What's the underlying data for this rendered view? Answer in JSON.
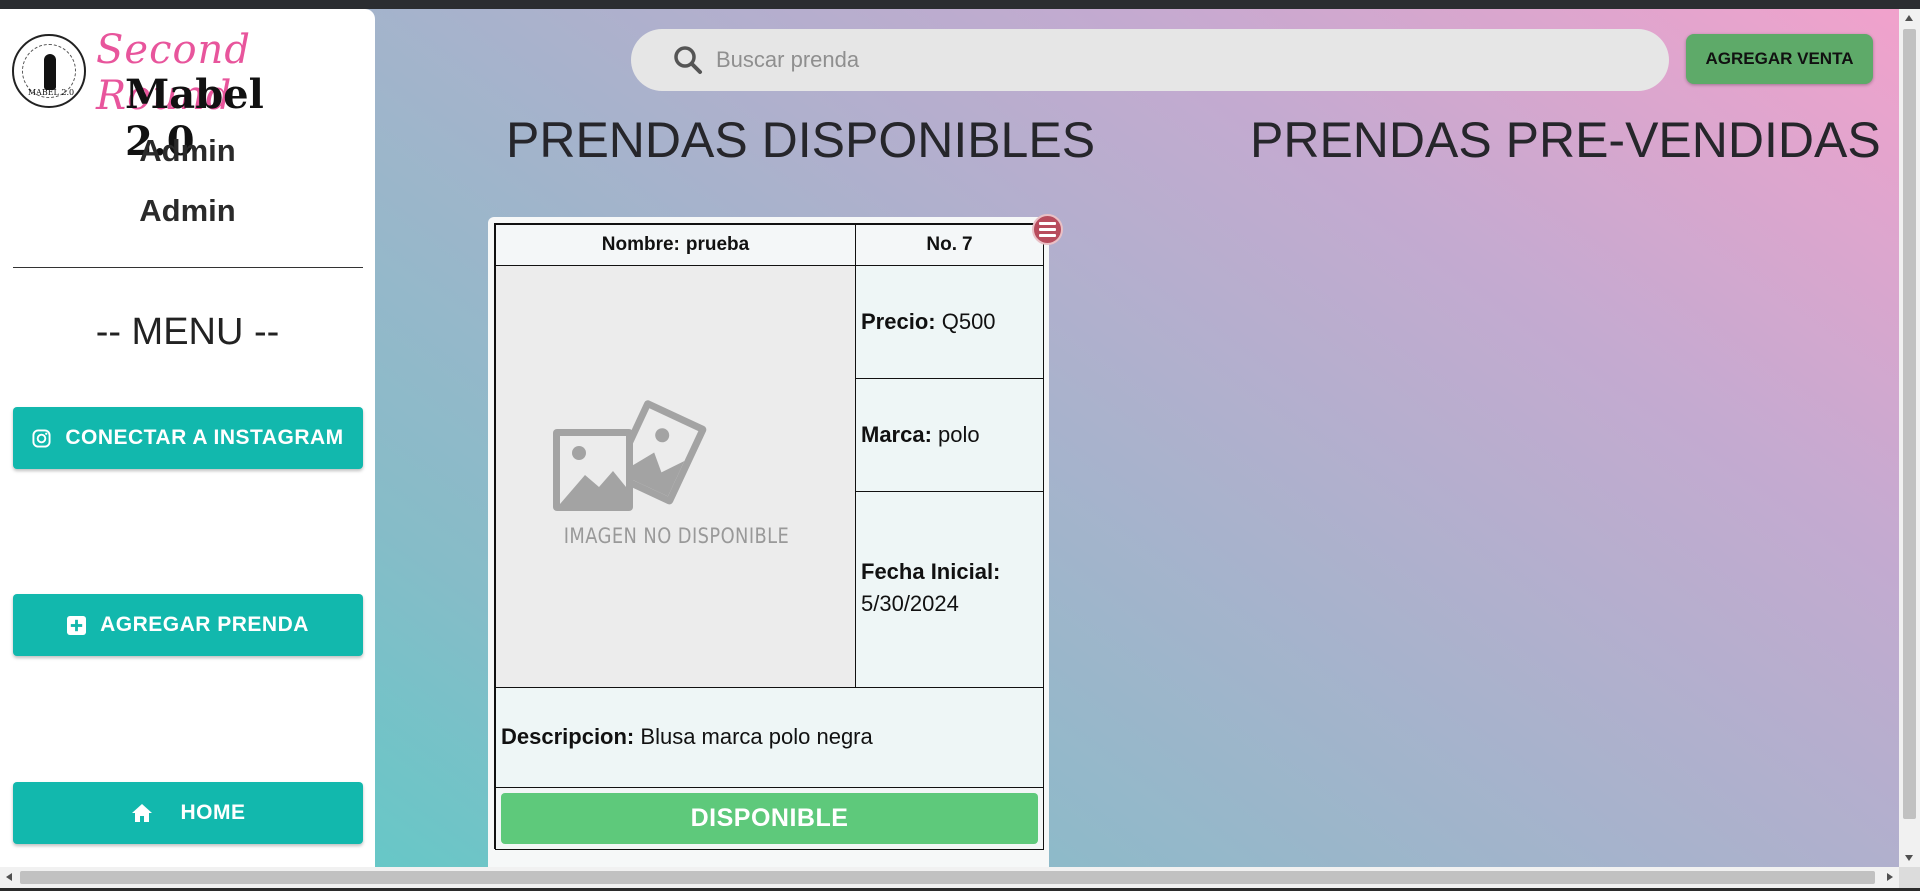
{
  "sidebar": {
    "logo": {
      "script": "Second Round",
      "title": "Mabel 2.0",
      "badge_text": "MABEL 2.0"
    },
    "user": {
      "name": "Admin",
      "role": "Admin"
    },
    "menu_heading": "-- MENU --",
    "buttons": {
      "instagram": "CONECTAR A INSTAGRAM",
      "agregar_prenda": "AGREGAR PRENDA",
      "home": "HOME"
    }
  },
  "header": {
    "search_placeholder": "Buscar prenda",
    "agregar_venta": "AGREGAR VENTA"
  },
  "sections": {
    "disponibles": "PRENDAS DISPONIBLES",
    "pre_vendidas": "PRENDAS PRE-VENDIDAS"
  },
  "card": {
    "nombre_label": "Nombre:",
    "nombre_value": "prueba",
    "no_label": "No.",
    "no_value": "7",
    "image_caption": "IMAGEN NO DISPONIBLE",
    "precio_label": "Precio:",
    "precio_value": "Q500",
    "marca_label": "Marca:",
    "marca_value": "polo",
    "fecha_label": "Fecha Inicial:",
    "fecha_value": "5/30/2024",
    "descripcion_label": "Descripcion:",
    "descripcion_value": "Blusa marca polo negra",
    "status": "DISPONIBLE"
  },
  "colors": {
    "teal_button": "#12b8ad",
    "green_status": "#5ec97b",
    "green_venta": "#5eaa69",
    "menu_red": "#b84c5d",
    "logo_pink": "#e8559c"
  }
}
